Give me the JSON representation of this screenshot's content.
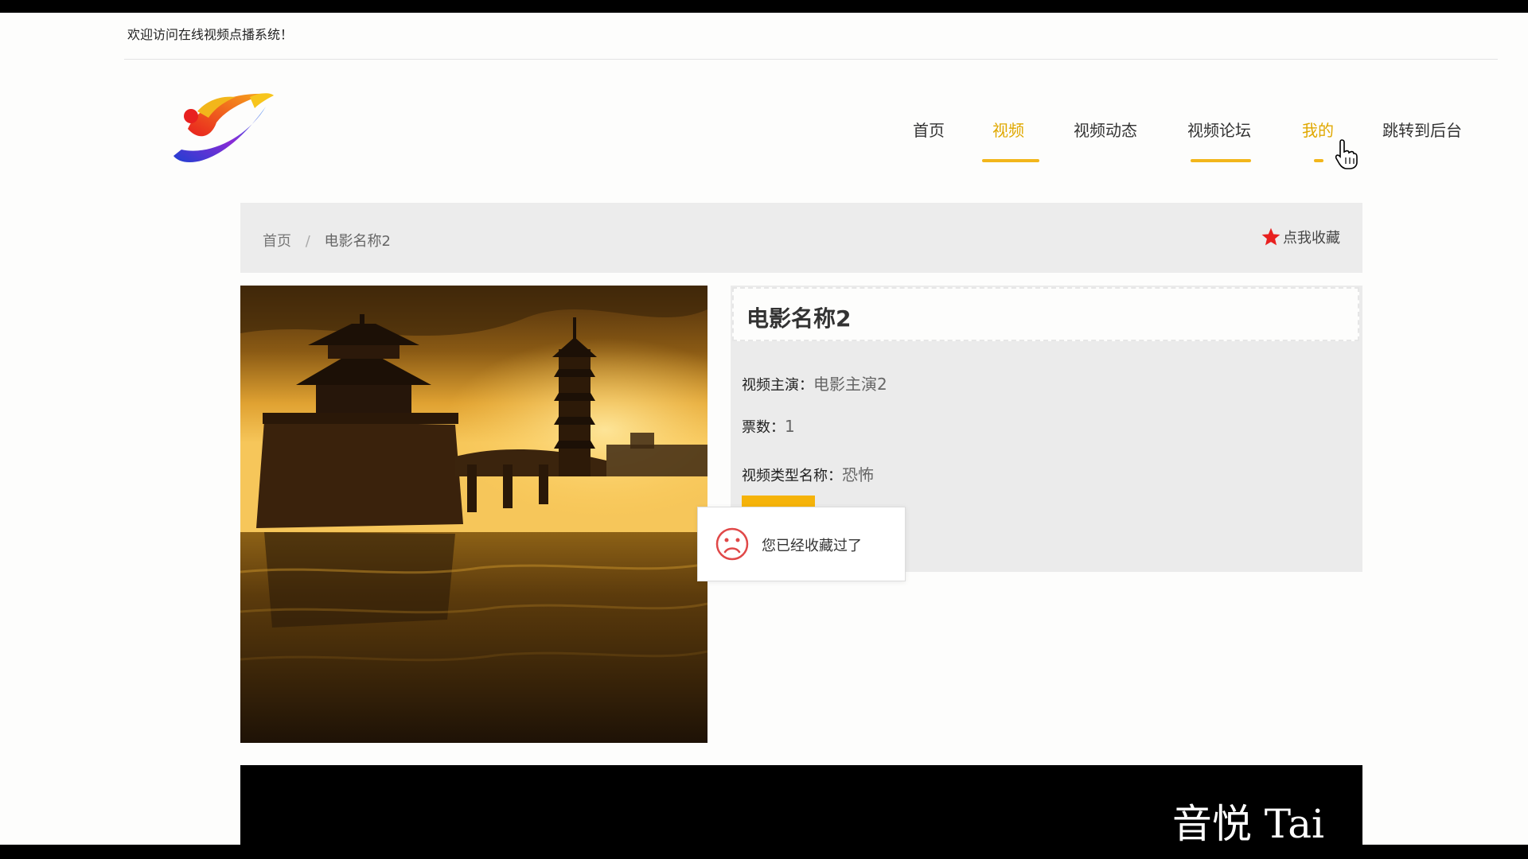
{
  "topbar": {
    "welcome": "欢迎访问在线视频点播系统！"
  },
  "nav": {
    "items": [
      {
        "label": "首页",
        "active": false
      },
      {
        "label": "视频",
        "active": true
      },
      {
        "label": "视频动态",
        "active": false
      },
      {
        "label": "视频论坛",
        "active": false
      },
      {
        "label": "我的",
        "active": true
      },
      {
        "label": "跳转到后台",
        "active": false
      }
    ]
  },
  "breadcrumb": {
    "home": "首页",
    "separator": "/",
    "current": "电影名称2"
  },
  "favorite": {
    "label": "点我收藏",
    "icon": "star-icon",
    "color": "#e8201f"
  },
  "movie": {
    "title": "电影名称2",
    "lead_label": "视频主演：",
    "lead_value": "电影主演2",
    "votes_label": "票数：",
    "votes_value": "1",
    "type_label": "视频类型名称：",
    "type_value": "恐怖"
  },
  "toast": {
    "message": "您已经收藏过了",
    "icon": "sad-face-icon"
  },
  "video": {
    "subtitle_right": "音悦 Tai"
  },
  "colors": {
    "accent": "#f2b61b",
    "button": "#f5b30a",
    "panel": "#ebebeb"
  }
}
